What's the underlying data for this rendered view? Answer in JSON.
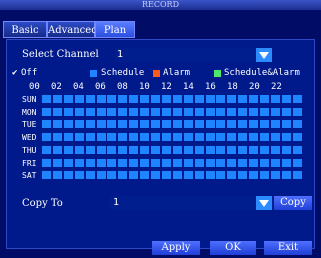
{
  "window": {
    "title": "RECORD"
  },
  "tabs": [
    {
      "label": "Basic"
    },
    {
      "label": "Advanced"
    },
    {
      "label": "Plan"
    }
  ],
  "channel": {
    "label": "Select Channel",
    "value": "1"
  },
  "legend": {
    "off": "Off",
    "schedule": "Schedule",
    "alarm": "Alarm",
    "schedule_alarm": "Schedule&Alarm"
  },
  "hours": [
    "00",
    "02",
    "04",
    "06",
    "08",
    "10",
    "12",
    "14",
    "16",
    "18",
    "20",
    "22"
  ],
  "days": [
    "SUN",
    "MON",
    "TUE",
    "WED",
    "THU",
    "FRI",
    "SAT"
  ],
  "schedule_mode": "Schedule",
  "copy_to": {
    "label": "Copy To",
    "value": "1",
    "button": "Copy"
  },
  "buttons": {
    "apply": "Apply",
    "ok": "OK",
    "exit": "Exit"
  },
  "colors": {
    "schedule": "#1e84ff",
    "alarm": "#ff5a1e",
    "schedule_alarm": "#4be86a",
    "off": "#ffffff"
  }
}
